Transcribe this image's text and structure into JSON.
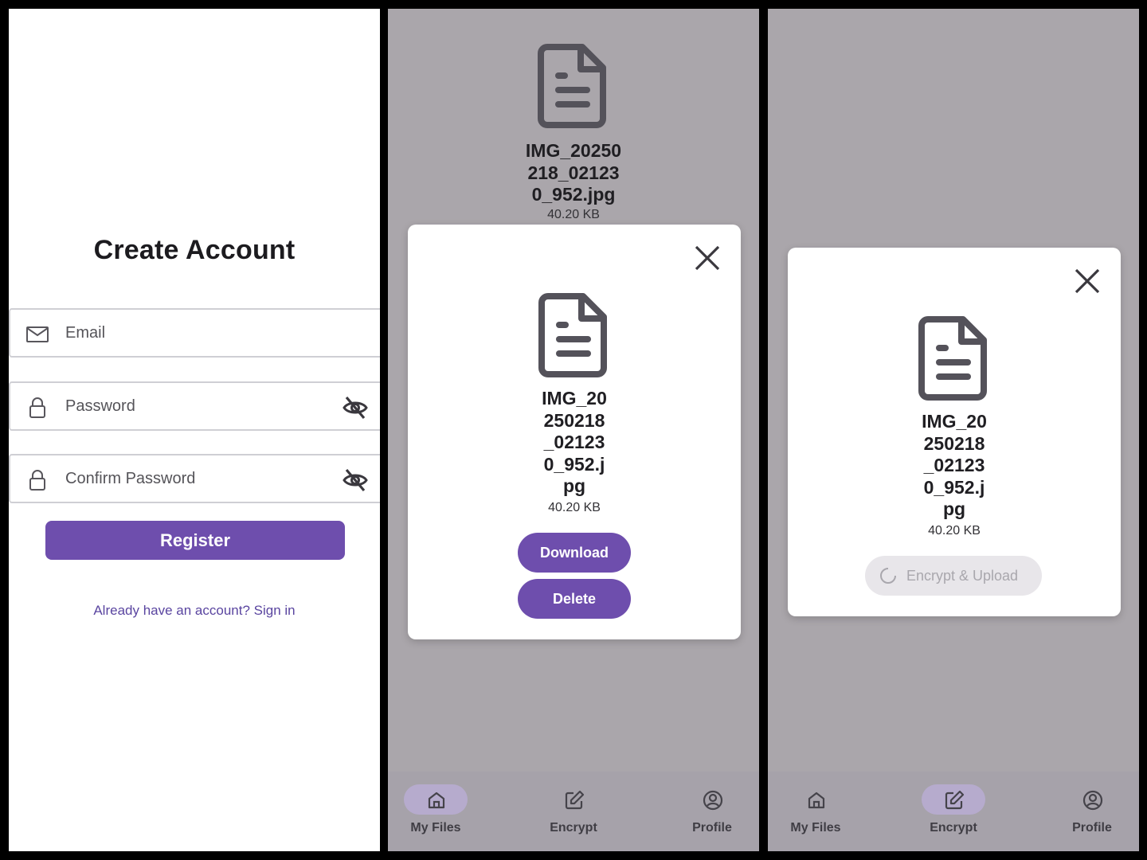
{
  "register_screen": {
    "title": "Create Account",
    "email_placeholder": "Email",
    "password_placeholder": "Password",
    "confirm_password_placeholder": "Confirm Password",
    "register_label": "Register",
    "signin_link": "Already have an account? Sign in",
    "icons": [
      "mail-icon",
      "lock-icon",
      "visibility-off-icon"
    ]
  },
  "file_screen": {
    "file_name_lines": [
      "IMG_20250",
      "218_02123",
      "0_952.jpg"
    ],
    "file_size": "40.20 KB",
    "modal": {
      "file_name_lines": [
        "IMG_20",
        "250218",
        "_02123",
        "0_952.j",
        "pg"
      ],
      "file_size": "40.20 KB",
      "download_label": "Download",
      "delete_label": "Delete"
    }
  },
  "encrypt_screen": {
    "modal": {
      "file_name_lines": [
        "IMG_20",
        "250218",
        "_02123",
        "0_952.j",
        "pg"
      ],
      "file_size": "40.20 KB",
      "encrypt_upload_label": "Encrypt & Upload",
      "encrypt_upload_state": "disabled-loading"
    }
  },
  "nav": {
    "items": [
      {
        "label": "My Files",
        "icon": "home-icon"
      },
      {
        "label": "Encrypt",
        "icon": "edit-icon"
      },
      {
        "label": "Profile",
        "icon": "account-circle-icon"
      }
    ],
    "active_panel2": "My Files",
    "active_panel3": "Encrypt"
  },
  "colors": {
    "accent": "#6e4ead",
    "overlay_background": "#aaa6ab",
    "nav_active_pill": "#b6abcd"
  }
}
